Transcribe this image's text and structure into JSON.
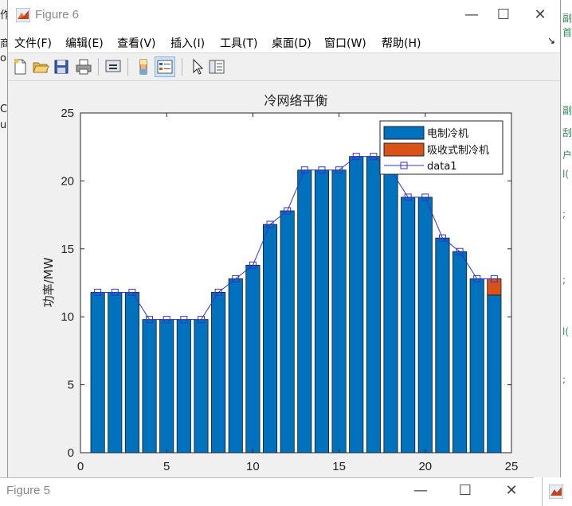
{
  "window": {
    "title": "Figure 6",
    "controls": {
      "minimize": "—",
      "maximize": "☐",
      "close": "✕"
    }
  },
  "menu": {
    "items": [
      "文件(F)",
      "编辑(E)",
      "查看(V)",
      "插入(I)",
      "工具(T)",
      "桌面(D)",
      "窗口(W)",
      "帮助(H)"
    ],
    "overflow": "↘"
  },
  "toolbar": {
    "buttons": [
      "new-figure",
      "open-file",
      "save",
      "print",
      "link-plot",
      "insert-colorbar",
      "insert-legend",
      "edit-plot",
      "open-property-inspector"
    ]
  },
  "chart_data": {
    "type": "bar",
    "title": "冷网络平衡",
    "xlabel": "",
    "ylabel": "功率/MW",
    "xlim": [
      0,
      25
    ],
    "ylim": [
      0,
      25
    ],
    "xticks": [
      0,
      5,
      10,
      15,
      20,
      25
    ],
    "yticks": [
      0,
      5,
      10,
      15,
      20,
      25
    ],
    "stacked": true,
    "x": [
      1,
      2,
      3,
      4,
      5,
      6,
      7,
      8,
      9,
      10,
      11,
      12,
      13,
      14,
      15,
      16,
      17,
      18,
      19,
      20,
      21,
      22,
      23,
      24
    ],
    "series": [
      {
        "name": "电制冷机",
        "color": "#0072bd",
        "values": [
          11.8,
          11.8,
          11.8,
          9.8,
          9.8,
          9.8,
          9.8,
          11.8,
          12.8,
          13.8,
          16.8,
          17.8,
          20.8,
          20.8,
          20.8,
          21.8,
          21.8,
          20.8,
          18.8,
          18.8,
          15.8,
          14.8,
          12.8,
          11.6
        ]
      },
      {
        "name": "吸收式制冷机",
        "color": "#d95319",
        "values": [
          0,
          0,
          0,
          0,
          0,
          0,
          0,
          0,
          0,
          0,
          0,
          0,
          0,
          0,
          0,
          0,
          0,
          0,
          0,
          0,
          0,
          0,
          0,
          1.2
        ]
      }
    ],
    "line": {
      "name": "data1",
      "color": "#3333cc",
      "marker": "square",
      "values": [
        11.8,
        11.8,
        11.8,
        9.8,
        9.8,
        9.8,
        9.8,
        11.8,
        12.8,
        13.8,
        16.8,
        17.8,
        20.8,
        20.8,
        20.8,
        21.8,
        21.8,
        20.8,
        18.8,
        18.8,
        15.8,
        14.8,
        12.8,
        12.8
      ]
    },
    "legend": {
      "position": "top-right",
      "entries": [
        "电制冷机",
        "吸收式制冷机",
        "data1"
      ]
    },
    "grid": false
  },
  "bottom_window": {
    "title": "Figure 5",
    "controls": {
      "minimize": "—",
      "maximize": "☐",
      "close": "✕"
    }
  },
  "background": {
    "left_fragments": [
      "作",
      "商",
      "or",
      "C",
      "ul"
    ],
    "right_fragments": [
      "副",
      "首",
      "副",
      "刮",
      "户",
      "l(",
      ";",
      ";",
      "l(",
      ";"
    ]
  }
}
